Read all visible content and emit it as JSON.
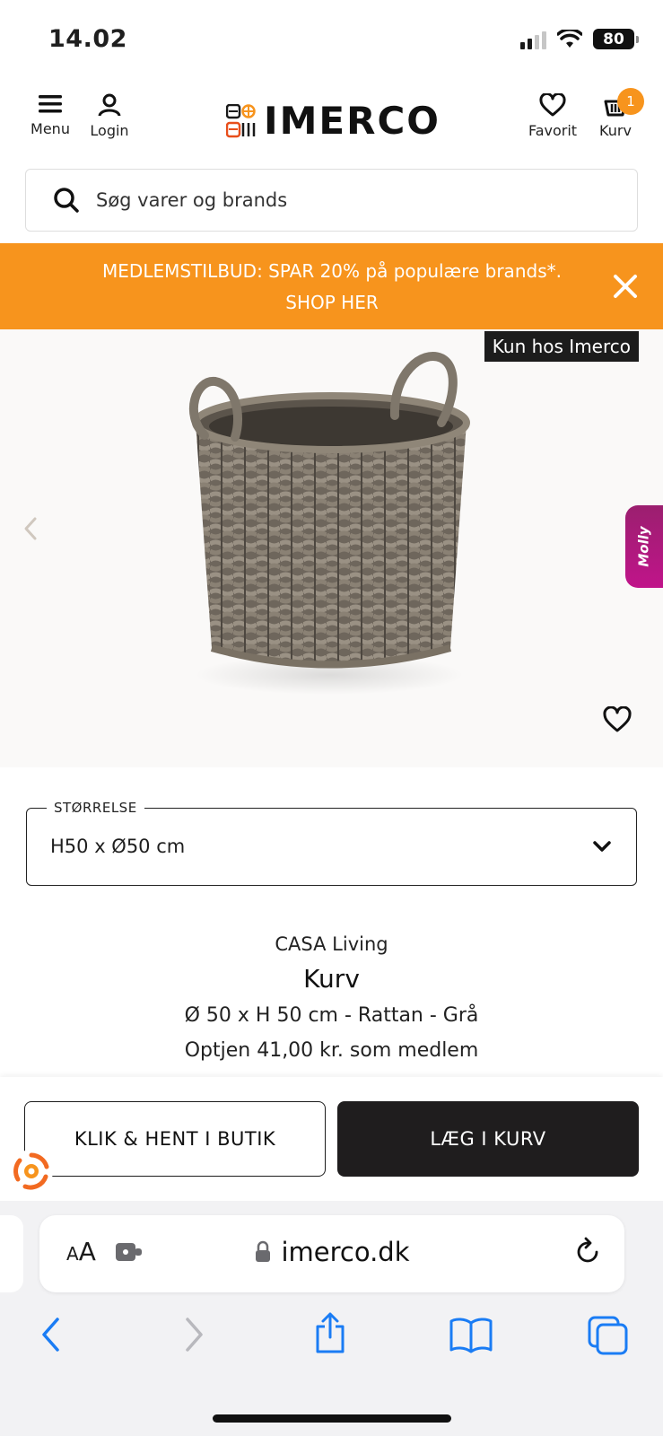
{
  "status_bar": {
    "time": "14.02",
    "battery": "80"
  },
  "header": {
    "menu_label": "Menu",
    "login_label": "Login",
    "logo_text": "IMERCO",
    "favorit_label": "Favorit",
    "cart_label": "Kurv",
    "cart_count": "1"
  },
  "search": {
    "placeholder": "Søg varer og brands"
  },
  "promo": {
    "line1": "MEDLEMSTILBUD: SPAR 20% på populære brands*.",
    "line2": "SHOP HER"
  },
  "product": {
    "badge": "Kun hos Imerco",
    "side_tab": "Molly",
    "size_legend": "STØRRELSE",
    "size_value": "H50 x Ø50 cm",
    "brand": "CASA Living",
    "title": "Kurv",
    "subtitle": "Ø 50 x H 50 cm - Rattan - Grå",
    "earn": "Optjen 41,00 kr. som medlem"
  },
  "actions": {
    "click_collect": "KLIK & HENT I BUTIK",
    "add_to_cart": "LÆG I KURV"
  },
  "browser": {
    "aa_small": "A",
    "aa_large": "A",
    "url": "imerco.dk"
  },
  "colors": {
    "accent_orange": "#f7941d",
    "dark": "#1f1d1e",
    "molly_purple": "#b0157f"
  }
}
